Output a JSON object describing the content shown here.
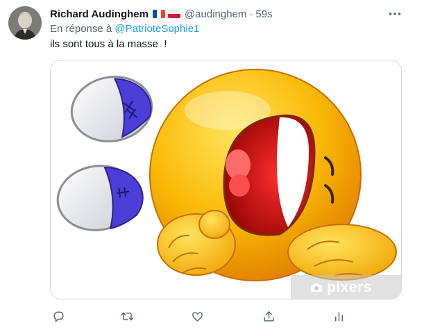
{
  "tweet": {
    "author_name": "Richard Audinghem",
    "author_handle": "@audinghem",
    "separator": "·",
    "time": "59s",
    "flags": [
      "flag-france-icon",
      "flag-poland-icon"
    ],
    "reply_prefix": "En réponse à ",
    "reply_to": "@PatrioteSophie1",
    "text": "ils sont tous à la masse  !",
    "media": {
      "description_icon": "laughing-emoji-image",
      "watermark_text": "pixers"
    },
    "actions": [
      "reply-icon",
      "retweet-icon",
      "like-icon",
      "share-icon",
      "analytics-icon"
    ]
  },
  "colors": {
    "text": "#0f1419",
    "secondary": "#536471",
    "link": "#1d9bf0",
    "border": "#cfd9de",
    "emoji_yellow": "#f7b500",
    "emoji_mouth": "#c8102e",
    "eye_blue": "#4b3fd8"
  }
}
